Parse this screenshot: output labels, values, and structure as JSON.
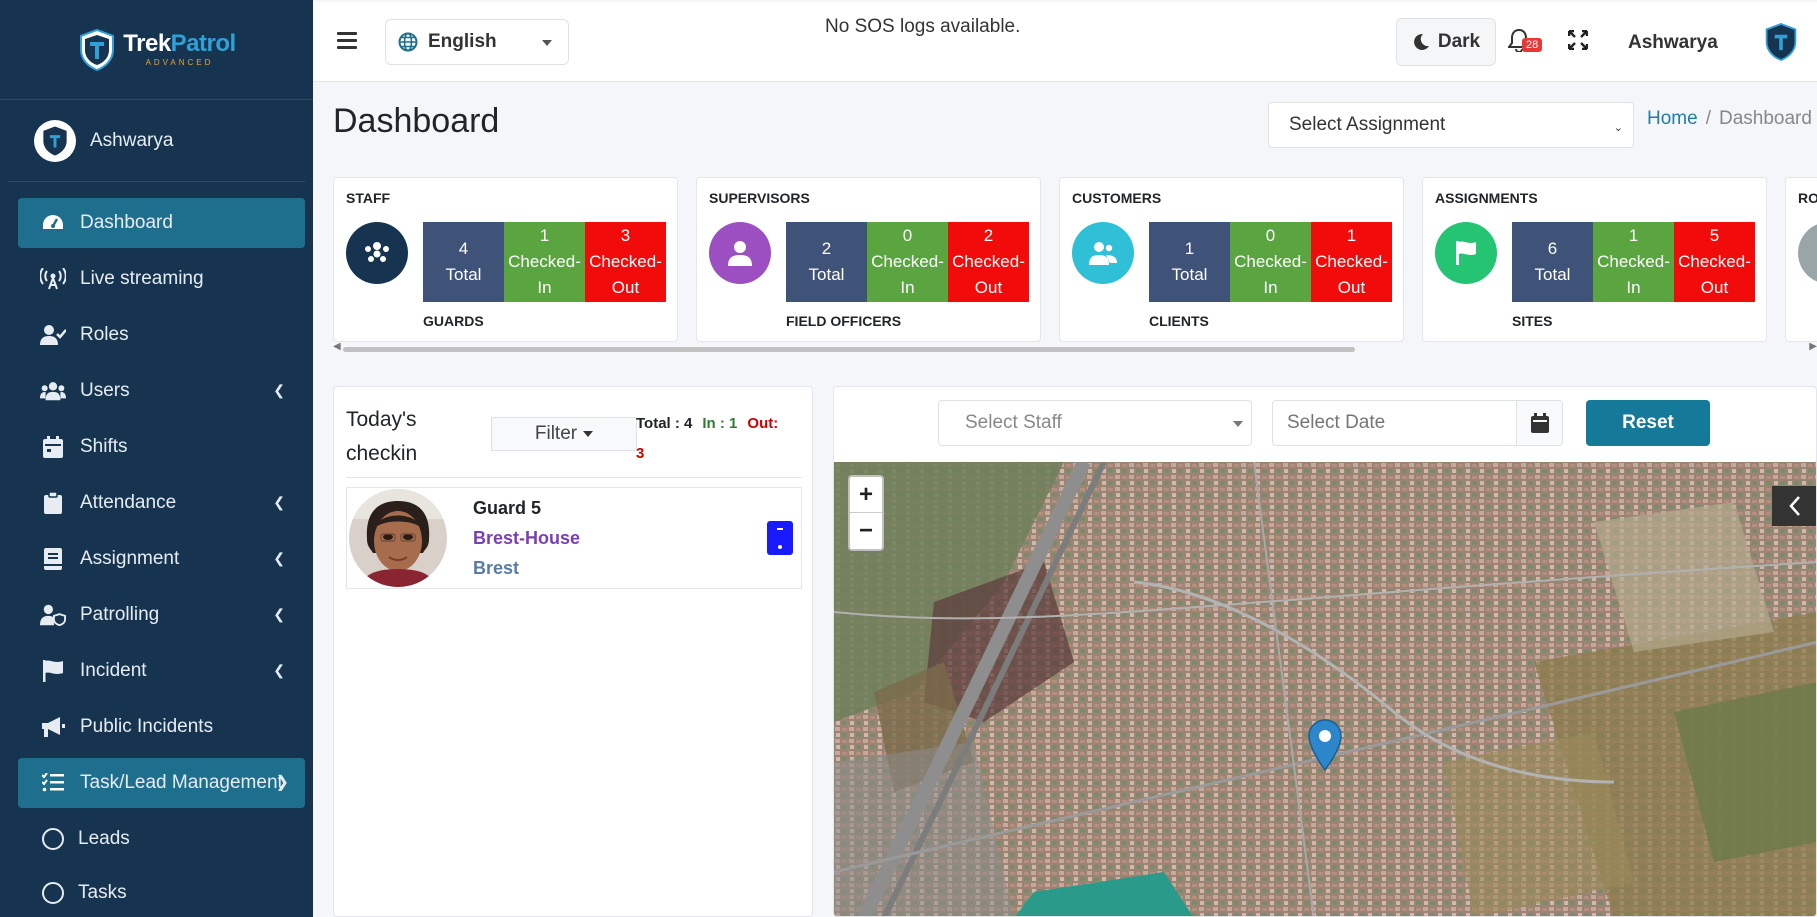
{
  "brand": {
    "logo_main_a": "Trek",
    "logo_main_b": "Patrol",
    "logo_sub": "ADVANCED"
  },
  "sidebar": {
    "user": "Ashwarya",
    "items": [
      {
        "label": "Dashboard",
        "icon": "dashboard-icon"
      },
      {
        "label": "Live streaming",
        "icon": "broadcast-icon"
      },
      {
        "label": "Roles",
        "icon": "user-check-icon"
      },
      {
        "label": "Users",
        "icon": "users-icon"
      },
      {
        "label": "Shifts",
        "icon": "calendar-icon"
      },
      {
        "label": "Attendance",
        "icon": "clipboard-icon"
      },
      {
        "label": "Assignment",
        "icon": "book-icon"
      },
      {
        "label": "Patrolling",
        "icon": "user-shield-icon"
      },
      {
        "label": "Incident",
        "icon": "flag-icon"
      },
      {
        "label": "Public Incidents",
        "icon": "megaphone-icon"
      },
      {
        "label": "Task/Lead Management",
        "icon": "list-icon"
      }
    ],
    "sub_items": [
      {
        "label": "Leads"
      },
      {
        "label": "Tasks"
      }
    ]
  },
  "topbar": {
    "language": "English",
    "sos_message": "No SOS logs available.",
    "theme_label": "Dark",
    "notification_count": "28",
    "user": "Ashwarya"
  },
  "header": {
    "title": "Dashboard",
    "assignment_placeholder": "Select Assignment",
    "breadcrumb_home": "Home",
    "breadcrumb_sep": "/",
    "breadcrumb_current": "Dashboard"
  },
  "cards": [
    {
      "title": "STAFF",
      "subtitle": "GUARDS",
      "icon": "guards-icon",
      "color": "#16344f",
      "total": "4",
      "total_label": "Total",
      "in": "1",
      "in_label": "Checked-In",
      "out": "3",
      "out_label": "Checked-Out"
    },
    {
      "title": "SUPERVISORS",
      "subtitle": "FIELD OFFICERS",
      "icon": "user-icon",
      "color": "#9c4fc0",
      "total": "2",
      "total_label": "Total",
      "in": "0",
      "in_label": "Checked-In",
      "out": "2",
      "out_label": "Checked-Out"
    },
    {
      "title": "CUSTOMERS",
      "subtitle": "CLIENTS",
      "icon": "clients-icon",
      "color": "#2fc0d8",
      "total": "1",
      "total_label": "Total",
      "in": "0",
      "in_label": "Checked-In",
      "out": "1",
      "out_label": "Checked-Out"
    },
    {
      "title": "ASSIGNMENTS",
      "subtitle": "SITES",
      "icon": "flag-icon",
      "color": "#24c472",
      "total": "6",
      "total_label": "Total",
      "in": "1",
      "in_label": "Checked-In",
      "out": "5",
      "out_label": "Checked-Out"
    },
    {
      "title": "RO",
      "subtitle": "",
      "icon": "partial-icon",
      "color": "#9aa5a8",
      "total": "",
      "total_label": "",
      "in": "",
      "in_label": "",
      "out": "",
      "out_label": ""
    }
  ],
  "checkin": {
    "title": "Today's checkin",
    "filter_label": "Filter",
    "total_label": "Total : 4",
    "in_label": "In : 1",
    "out_label": "Out:",
    "out_value": "3",
    "entries": [
      {
        "name": "Guard 5",
        "site": "Brest-House",
        "city": "Brest"
      }
    ]
  },
  "map_filters": {
    "staff_placeholder": "Select Staff",
    "date_placeholder": "Select Date",
    "reset_label": "Reset",
    "zoom_in": "+",
    "zoom_out": "−"
  }
}
